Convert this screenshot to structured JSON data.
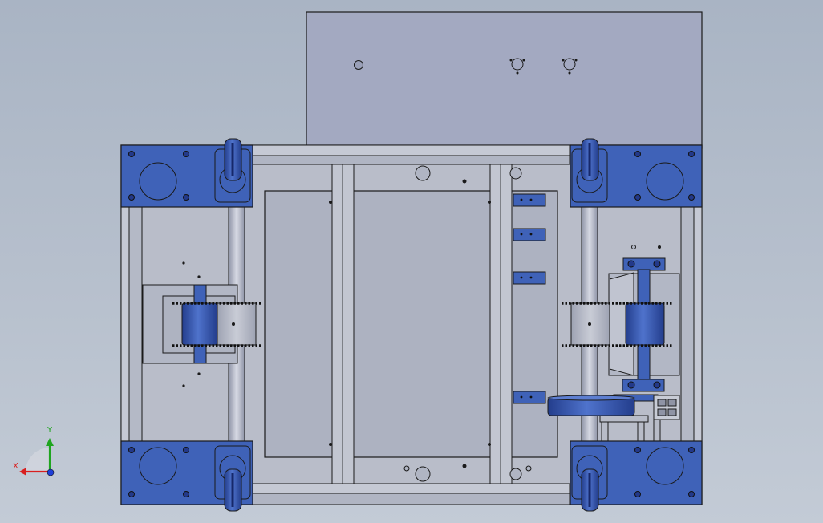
{
  "viewport": {
    "background_top": "#a9b4c4",
    "background_bottom": "#c3cbd6"
  },
  "colors": {
    "plate_fill": "#a3a9c1",
    "frame_fill": "#b7bcc9",
    "part_blue": "#3f62b8",
    "part_blue_dark": "#23398a",
    "edge": "#1a1a1a",
    "axis_x": "#d81f1f",
    "axis_y": "#1fa51f",
    "axis_z": "#1f3fd8"
  },
  "triad": {
    "x_label": "X",
    "y_label": "Y",
    "icon": "coordinate-triad-icon"
  }
}
